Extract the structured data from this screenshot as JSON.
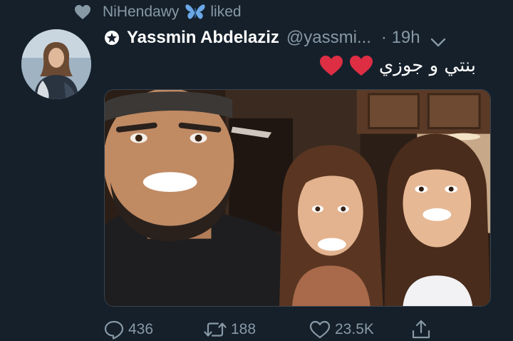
{
  "social_context": {
    "liker_name": "NiHendawy",
    "action": "liked"
  },
  "tweet": {
    "display_name": "Yassmin Abdelaziz",
    "handle": "@yassmi...",
    "timestamp": "· 19h",
    "text": "بنتي و جوزي",
    "emoji": [
      "red-heart",
      "red-heart"
    ]
  },
  "actions": {
    "replies": "436",
    "retweets": "188",
    "likes": "23.5K"
  },
  "colors": {
    "background": "#15202b",
    "secondary_text": "#8899a6",
    "heart_red": "#dd2e44",
    "butterfly_blue": "#6aa8e6"
  },
  "icons": [
    "heart-outline-icon",
    "butterfly-icon",
    "star-badge-icon",
    "chevron-down-icon",
    "reply-icon",
    "retweet-icon",
    "like-icon",
    "share-icon"
  ]
}
